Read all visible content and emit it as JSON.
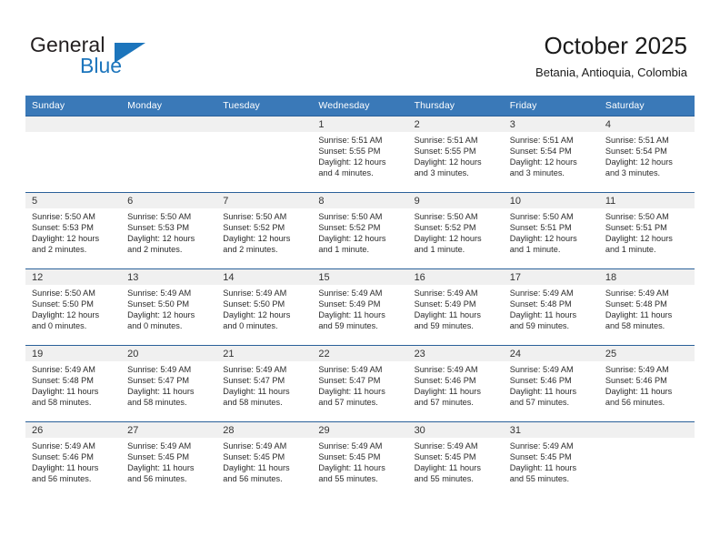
{
  "brand": {
    "name_top": "General",
    "name_bottom": "Blue",
    "accent_color": "#1c75bc"
  },
  "header": {
    "title": "October 2025",
    "subtitle": "Betania, Antioquia, Colombia"
  },
  "theme": {
    "header_row_bg": "#3a79b8",
    "cell_top_border": "#2a6099",
    "daynum_band_bg": "#f0f0f0"
  },
  "weekdays": [
    "Sunday",
    "Monday",
    "Tuesday",
    "Wednesday",
    "Thursday",
    "Friday",
    "Saturday"
  ],
  "weeks": [
    [
      {
        "day": "",
        "sunrise": "",
        "sunset": "",
        "daylight1": "",
        "daylight2": ""
      },
      {
        "day": "",
        "sunrise": "",
        "sunset": "",
        "daylight1": "",
        "daylight2": ""
      },
      {
        "day": "",
        "sunrise": "",
        "sunset": "",
        "daylight1": "",
        "daylight2": ""
      },
      {
        "day": "1",
        "sunrise": "Sunrise: 5:51 AM",
        "sunset": "Sunset: 5:55 PM",
        "daylight1": "Daylight: 12 hours",
        "daylight2": "and 4 minutes."
      },
      {
        "day": "2",
        "sunrise": "Sunrise: 5:51 AM",
        "sunset": "Sunset: 5:55 PM",
        "daylight1": "Daylight: 12 hours",
        "daylight2": "and 3 minutes."
      },
      {
        "day": "3",
        "sunrise": "Sunrise: 5:51 AM",
        "sunset": "Sunset: 5:54 PM",
        "daylight1": "Daylight: 12 hours",
        "daylight2": "and 3 minutes."
      },
      {
        "day": "4",
        "sunrise": "Sunrise: 5:51 AM",
        "sunset": "Sunset: 5:54 PM",
        "daylight1": "Daylight: 12 hours",
        "daylight2": "and 3 minutes."
      }
    ],
    [
      {
        "day": "5",
        "sunrise": "Sunrise: 5:50 AM",
        "sunset": "Sunset: 5:53 PM",
        "daylight1": "Daylight: 12 hours",
        "daylight2": "and 2 minutes."
      },
      {
        "day": "6",
        "sunrise": "Sunrise: 5:50 AM",
        "sunset": "Sunset: 5:53 PM",
        "daylight1": "Daylight: 12 hours",
        "daylight2": "and 2 minutes."
      },
      {
        "day": "7",
        "sunrise": "Sunrise: 5:50 AM",
        "sunset": "Sunset: 5:52 PM",
        "daylight1": "Daylight: 12 hours",
        "daylight2": "and 2 minutes."
      },
      {
        "day": "8",
        "sunrise": "Sunrise: 5:50 AM",
        "sunset": "Sunset: 5:52 PM",
        "daylight1": "Daylight: 12 hours",
        "daylight2": "and 1 minute."
      },
      {
        "day": "9",
        "sunrise": "Sunrise: 5:50 AM",
        "sunset": "Sunset: 5:52 PM",
        "daylight1": "Daylight: 12 hours",
        "daylight2": "and 1 minute."
      },
      {
        "day": "10",
        "sunrise": "Sunrise: 5:50 AM",
        "sunset": "Sunset: 5:51 PM",
        "daylight1": "Daylight: 12 hours",
        "daylight2": "and 1 minute."
      },
      {
        "day": "11",
        "sunrise": "Sunrise: 5:50 AM",
        "sunset": "Sunset: 5:51 PM",
        "daylight1": "Daylight: 12 hours",
        "daylight2": "and 1 minute."
      }
    ],
    [
      {
        "day": "12",
        "sunrise": "Sunrise: 5:50 AM",
        "sunset": "Sunset: 5:50 PM",
        "daylight1": "Daylight: 12 hours",
        "daylight2": "and 0 minutes."
      },
      {
        "day": "13",
        "sunrise": "Sunrise: 5:49 AM",
        "sunset": "Sunset: 5:50 PM",
        "daylight1": "Daylight: 12 hours",
        "daylight2": "and 0 minutes."
      },
      {
        "day": "14",
        "sunrise": "Sunrise: 5:49 AM",
        "sunset": "Sunset: 5:50 PM",
        "daylight1": "Daylight: 12 hours",
        "daylight2": "and 0 minutes."
      },
      {
        "day": "15",
        "sunrise": "Sunrise: 5:49 AM",
        "sunset": "Sunset: 5:49 PM",
        "daylight1": "Daylight: 11 hours",
        "daylight2": "and 59 minutes."
      },
      {
        "day": "16",
        "sunrise": "Sunrise: 5:49 AM",
        "sunset": "Sunset: 5:49 PM",
        "daylight1": "Daylight: 11 hours",
        "daylight2": "and 59 minutes."
      },
      {
        "day": "17",
        "sunrise": "Sunrise: 5:49 AM",
        "sunset": "Sunset: 5:48 PM",
        "daylight1": "Daylight: 11 hours",
        "daylight2": "and 59 minutes."
      },
      {
        "day": "18",
        "sunrise": "Sunrise: 5:49 AM",
        "sunset": "Sunset: 5:48 PM",
        "daylight1": "Daylight: 11 hours",
        "daylight2": "and 58 minutes."
      }
    ],
    [
      {
        "day": "19",
        "sunrise": "Sunrise: 5:49 AM",
        "sunset": "Sunset: 5:48 PM",
        "daylight1": "Daylight: 11 hours",
        "daylight2": "and 58 minutes."
      },
      {
        "day": "20",
        "sunrise": "Sunrise: 5:49 AM",
        "sunset": "Sunset: 5:47 PM",
        "daylight1": "Daylight: 11 hours",
        "daylight2": "and 58 minutes."
      },
      {
        "day": "21",
        "sunrise": "Sunrise: 5:49 AM",
        "sunset": "Sunset: 5:47 PM",
        "daylight1": "Daylight: 11 hours",
        "daylight2": "and 58 minutes."
      },
      {
        "day": "22",
        "sunrise": "Sunrise: 5:49 AM",
        "sunset": "Sunset: 5:47 PM",
        "daylight1": "Daylight: 11 hours",
        "daylight2": "and 57 minutes."
      },
      {
        "day": "23",
        "sunrise": "Sunrise: 5:49 AM",
        "sunset": "Sunset: 5:46 PM",
        "daylight1": "Daylight: 11 hours",
        "daylight2": "and 57 minutes."
      },
      {
        "day": "24",
        "sunrise": "Sunrise: 5:49 AM",
        "sunset": "Sunset: 5:46 PM",
        "daylight1": "Daylight: 11 hours",
        "daylight2": "and 57 minutes."
      },
      {
        "day": "25",
        "sunrise": "Sunrise: 5:49 AM",
        "sunset": "Sunset: 5:46 PM",
        "daylight1": "Daylight: 11 hours",
        "daylight2": "and 56 minutes."
      }
    ],
    [
      {
        "day": "26",
        "sunrise": "Sunrise: 5:49 AM",
        "sunset": "Sunset: 5:46 PM",
        "daylight1": "Daylight: 11 hours",
        "daylight2": "and 56 minutes."
      },
      {
        "day": "27",
        "sunrise": "Sunrise: 5:49 AM",
        "sunset": "Sunset: 5:45 PM",
        "daylight1": "Daylight: 11 hours",
        "daylight2": "and 56 minutes."
      },
      {
        "day": "28",
        "sunrise": "Sunrise: 5:49 AM",
        "sunset": "Sunset: 5:45 PM",
        "daylight1": "Daylight: 11 hours",
        "daylight2": "and 56 minutes."
      },
      {
        "day": "29",
        "sunrise": "Sunrise: 5:49 AM",
        "sunset": "Sunset: 5:45 PM",
        "daylight1": "Daylight: 11 hours",
        "daylight2": "and 55 minutes."
      },
      {
        "day": "30",
        "sunrise": "Sunrise: 5:49 AM",
        "sunset": "Sunset: 5:45 PM",
        "daylight1": "Daylight: 11 hours",
        "daylight2": "and 55 minutes."
      },
      {
        "day": "31",
        "sunrise": "Sunrise: 5:49 AM",
        "sunset": "Sunset: 5:45 PM",
        "daylight1": "Daylight: 11 hours",
        "daylight2": "and 55 minutes."
      },
      {
        "day": "",
        "sunrise": "",
        "sunset": "",
        "daylight1": "",
        "daylight2": ""
      }
    ]
  ]
}
